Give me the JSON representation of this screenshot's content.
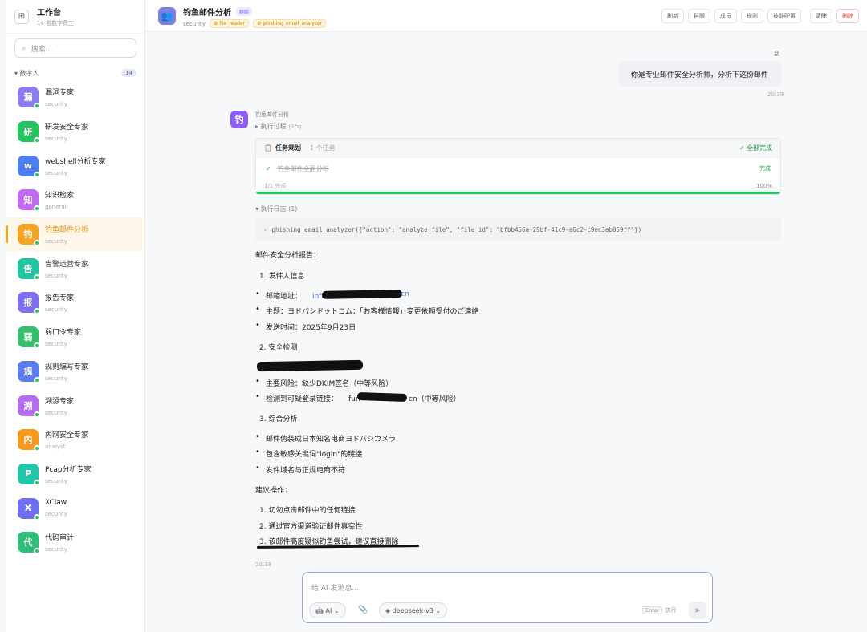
{
  "workspace": {
    "title": "工作台",
    "subtitle": "14 名数字员工",
    "icon": "grid-icon"
  },
  "search": {
    "placeholder": "搜索..."
  },
  "group": {
    "label": "▾ 数字人",
    "count": "14"
  },
  "agents": [
    {
      "char": "漏",
      "name": "漏洞专家",
      "cat": "security",
      "color": "#8b7cf0"
    },
    {
      "char": "研",
      "name": "研发安全专家",
      "cat": "security",
      "color": "#22c55e"
    },
    {
      "char": "w",
      "name": "webshell分析专家",
      "cat": "security",
      "color": "#4f7ef0"
    },
    {
      "char": "知",
      "name": "知识检索",
      "cat": "general",
      "color": "#c06bf2"
    },
    {
      "char": "钓",
      "name": "钓鱼邮件分析",
      "cat": "security",
      "color": "#f5a524"
    },
    {
      "char": "告",
      "name": "告警运营专家",
      "cat": "security",
      "color": "#22c5a0"
    },
    {
      "char": "报",
      "name": "报告专家",
      "cat": "security",
      "color": "#7c6ff0"
    },
    {
      "char": "弱",
      "name": "弱口令专家",
      "cat": "security",
      "color": "#34c06a"
    },
    {
      "char": "规",
      "name": "规则编写专家",
      "cat": "security",
      "color": "#5b7df0"
    },
    {
      "char": "溯",
      "name": "溯源专家",
      "cat": "security",
      "color": "#b56df0"
    },
    {
      "char": "内",
      "name": "内网安全专家",
      "cat": "analyst",
      "color": "#f59a1e"
    },
    {
      "char": "P",
      "name": "Pcap分析专家",
      "cat": "security",
      "color": "#22c5a8"
    },
    {
      "char": "X",
      "name": "XClaw",
      "cat": "security",
      "color": "#6f6ff0"
    },
    {
      "char": "代",
      "name": "代码审计",
      "cat": "security",
      "color": "#2ec07a"
    }
  ],
  "header": {
    "title": "钓鱼邮件分析",
    "badge": "群聊",
    "category": "security",
    "tools": [
      "file_reader",
      "phishing_email_analyzer"
    ],
    "actions": [
      "刷新",
      "群聊",
      "成员",
      "规则",
      "技能配置",
      "清除",
      "删除"
    ]
  },
  "user_msg": {
    "label": "我",
    "text": "你是专业邮件安全分析师，分析下这份邮件",
    "time": "20:39"
  },
  "bot": {
    "avatar": "钓",
    "name": "钓鱼邮件分析",
    "exec_label": "▸ 执行过程",
    "exec_count": "(15)",
    "plan": {
      "title": "任务规划",
      "count": "· 1 个任务",
      "status": "✓ 全部完成",
      "task": "钓鱼邮件全面分析",
      "task_status": "完成",
      "progress_label": "1/1 完成",
      "progress_pct": "100%",
      "progress": 1.0
    },
    "log_label": "▾ 执行日志 (1)",
    "log_text": "phishing_email_analyzer({\"action\": \"analyze_file\", \"file_id\": \"bfbb456a-29bf-41c9-a6c2-c9ec3ab059ff\"})",
    "time": "20:39"
  },
  "report": {
    "title": "邮件安全分析报告：",
    "s1": "1. 发件人信息",
    "s1_items": [
      "邮箱地址：",
      "主题：ヨドバシドットコム：「お客様情報」変更依頼受付のご連絡",
      "发送时间：2025年9月23日"
    ],
    "email_start": "info",
    "email_end": "cn",
    "s2": "2. 安全检测",
    "s2_items": [
      "主要风险：缺少DKIM签名（中等风险）",
      "检测到可疑登录链接："
    ],
    "link_start": "fun",
    "link_end": "cn（中等风险）",
    "s3": "3. 综合分析",
    "s3_items": [
      "邮件伪装成日本知名电商ヨドバシカメラ",
      "包含敏感关键词\"login\"的链接",
      "发件域名与正规电商不符"
    ],
    "suggest": "建议操作：",
    "steps": [
      "1. 切勿点击邮件中的任何链接",
      "2. 通过官方渠道验证邮件真实性",
      "3. 该邮件高度疑似钓鱼尝试，建议直接删除"
    ]
  },
  "composer": {
    "placeholder": "给 AI 发消息...",
    "mode": "AI",
    "model": "deepseek-v3",
    "enter_key": "Enter",
    "enter_label": "执行"
  }
}
